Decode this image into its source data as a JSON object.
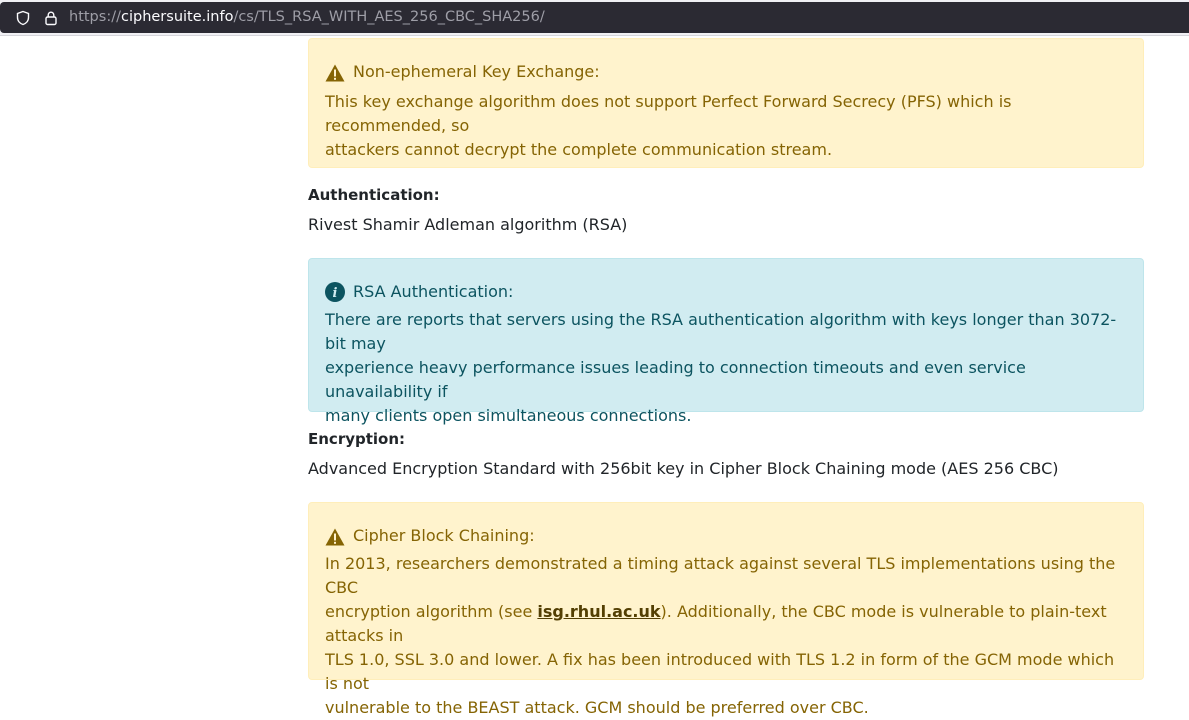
{
  "browser": {
    "url_scheme": "https://",
    "url_host": "ciphersuite.info",
    "url_path": "/cs/TLS_RSA_WITH_AES_256_CBC_SHA256/",
    "icons": [
      "shield-icon",
      "lock-icon"
    ]
  },
  "key_exchange_alert": {
    "icon": "warning-icon",
    "title": "Non-ephemeral Key Exchange:",
    "line1": "This key exchange algorithm does not support Perfect Forward Secrecy (PFS) which is recommended, so",
    "line2": "attackers cannot decrypt the complete communication stream."
  },
  "authentication": {
    "label": "Authentication:",
    "value": "Rivest Shamir Adleman algorithm (RSA)"
  },
  "rsa_alert": {
    "icon": "info-icon",
    "title": "RSA Authentication:",
    "line1": "There are reports that servers using the RSA authentication algorithm with keys longer than 3072-bit may",
    "line2": "experience heavy performance issues leading to connection timeouts and even service unavailability if",
    "line3": "many clients open simultaneous connections."
  },
  "encryption": {
    "label": "Encryption:",
    "value": "Advanced Encryption Standard with 256bit key in Cipher Block Chaining mode (AES 256 CBC)"
  },
  "cbc_alert": {
    "icon": "warning-icon",
    "title": "Cipher Block Chaining:",
    "line1": "In 2013, researchers demonstrated a timing attack against several TLS implementations using the CBC",
    "line2_before": "encryption algorithm (see ",
    "line2_link": "isg.rhul.ac.uk",
    "line2_after": "). Additionally, the CBC mode is vulnerable to plain-text attacks in",
    "line3": "TLS 1.0, SSL 3.0 and lower. A fix has been introduced with TLS 1.2 in form of the GCM mode which is not",
    "line4": "vulnerable to the BEAST attack. GCM should be preferred over CBC."
  },
  "colors": {
    "warning_bg": "#fff3cd",
    "warning_text": "#856404",
    "info_bg": "#d1ecf1",
    "info_text": "#0c5460",
    "urlbar_bg": "#2b2a33"
  }
}
